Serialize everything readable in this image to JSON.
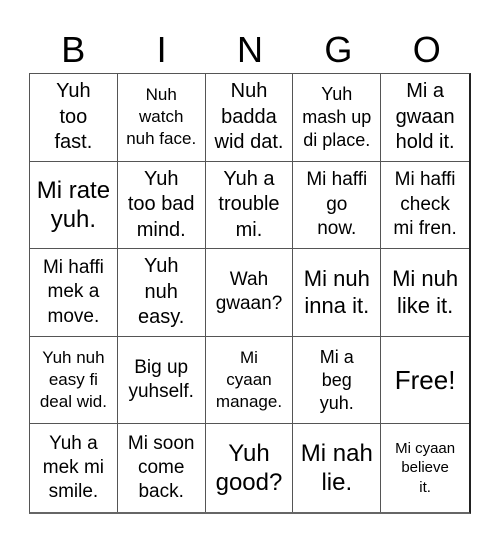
{
  "header": {
    "letters": [
      "B",
      "I",
      "N",
      "G",
      "O"
    ]
  },
  "board": {
    "rows": [
      [
        "Yuh\ntoo\nfast.",
        "Nuh\nwatch\nnuh face.",
        "Nuh\nbadda\nwid dat.",
        "Yuh\nmash up\ndi place.",
        "Mi a\ngwaan\nhold it."
      ],
      [
        "Mi rate\nyuh.",
        "Yuh\ntoo bad\nmind.",
        "Yuh a\ntrouble\nmi.",
        "Mi haffi\ngo\nnow.",
        "Mi haffi\ncheck\nmi fren."
      ],
      [
        "Mi haffi\nmek a\nmove.",
        "Yuh\nnuh\neasy.",
        "Wah\ngwaan?",
        "Mi nuh\ninna it.",
        "Mi nuh\nlike it."
      ],
      [
        "Yuh nuh\neasy fi\ndeal wid.",
        "Big up\nyuhself.",
        "Mi\ncyaan\nmanage.",
        "Mi a\nbeg\nyuh.",
        "Free!"
      ],
      [
        "Yuh a\nmek mi\nsmile.",
        "Mi soon\ncome\nback.",
        "Yuh\ngood?",
        "Mi nah\nlie.",
        "Mi cyaan\nbelieve\nit."
      ]
    ],
    "free_cell": "Free!"
  }
}
